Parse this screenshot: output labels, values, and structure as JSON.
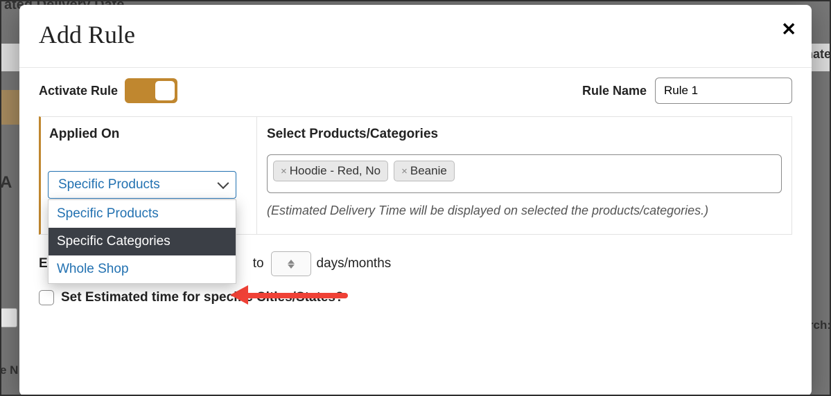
{
  "background": {
    "page_title": "ated Delivery Date",
    "tab_right": "mate",
    "left_a": "A",
    "search_label": "rch:",
    "e_n": "e N"
  },
  "modal": {
    "title": "Add Rule",
    "activate_label": "Activate Rule",
    "activate_on": true,
    "rule_name_label": "Rule Name",
    "rule_name_value": "Rule 1",
    "applied_on_label": "Applied On",
    "applied_on_selected": "Specific Products",
    "applied_on_options": [
      "Specific Products",
      "Specific Categories",
      "Whole Shop"
    ],
    "applied_on_highlight_index": 1,
    "select_products_label": "Select Products/Categories",
    "tags": [
      "Hoodie - Red, No",
      "Beanie"
    ],
    "hint": "(Estimated Delivery Time will be displayed on selected the products/categories.)",
    "mid_row": {
      "prefix_letter": "E",
      "to": "to",
      "unit": "days/months"
    },
    "checkbox_label": "Set Estimated time for specific Cities/States?",
    "checkbox_checked": false
  }
}
